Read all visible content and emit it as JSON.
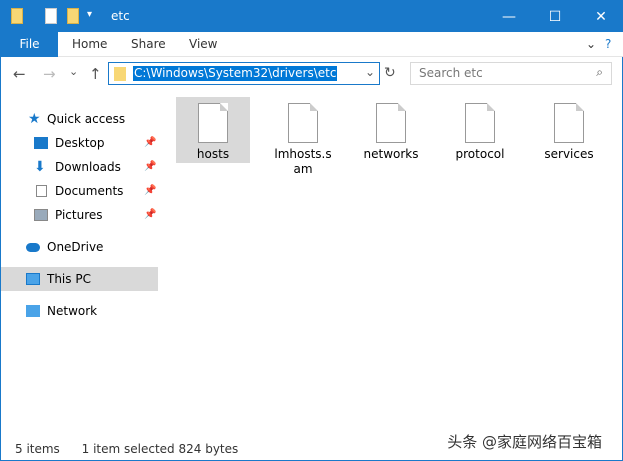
{
  "window": {
    "title": "etc",
    "minimize": "—",
    "maximize": "☐",
    "close": "✕"
  },
  "ribbon": {
    "tabs": [
      "File",
      "Home",
      "Share",
      "View"
    ],
    "expand": "⌄",
    "help": "?"
  },
  "nav": {
    "back": "←",
    "forward": "→",
    "recent": "⌄",
    "up": "↑",
    "address": "C:\\Windows\\System32\\drivers\\etc",
    "dropdown": "⌄",
    "refresh": "↻",
    "search_placeholder": "Search etc",
    "search_icon": "⌕"
  },
  "sidebar": {
    "items": [
      {
        "label": "Quick access",
        "icon": "star-icon"
      },
      {
        "label": "Desktop",
        "icon": "desktop-icon",
        "pinned": true
      },
      {
        "label": "Downloads",
        "icon": "download-icon",
        "pinned": true
      },
      {
        "label": "Documents",
        "icon": "documents-icon",
        "pinned": true
      },
      {
        "label": "Pictures",
        "icon": "pictures-icon",
        "pinned": true
      },
      {
        "label": "OneDrive",
        "icon": "cloud-icon"
      },
      {
        "label": "This PC",
        "icon": "computer-icon",
        "selected": true
      },
      {
        "label": "Network",
        "icon": "network-icon"
      }
    ]
  },
  "files": [
    {
      "name": "hosts",
      "selected": true
    },
    {
      "name": "lmhosts.sam"
    },
    {
      "name": "networks"
    },
    {
      "name": "protocol"
    },
    {
      "name": "services"
    }
  ],
  "status": {
    "count": "5 items",
    "selected": "1 item selected  824 bytes"
  },
  "watermark": "头条 @家庭网络百宝箱"
}
